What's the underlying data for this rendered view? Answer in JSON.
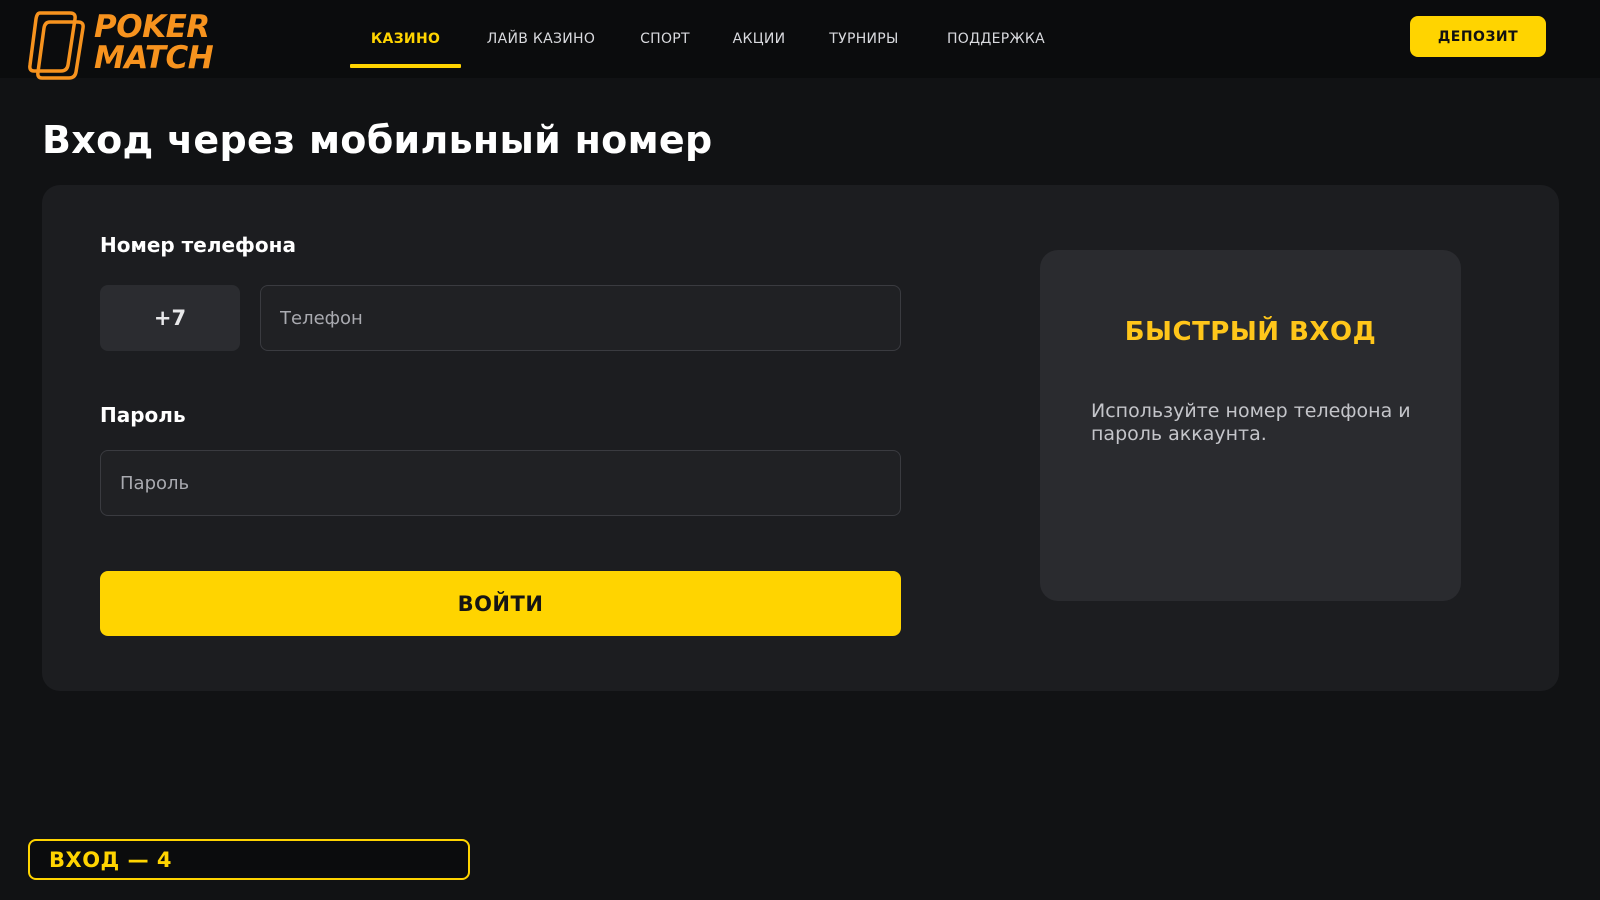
{
  "brand": {
    "line1": "POKER",
    "line2": "MATCH",
    "color": "#f7931e"
  },
  "nav": {
    "items": [
      {
        "label": "КАЗИНО",
        "active": true
      },
      {
        "label": "ЛАЙВ КАЗИНО",
        "active": false
      },
      {
        "label": "СПОРТ",
        "active": false
      },
      {
        "label": "АКЦИИ",
        "active": false
      },
      {
        "label": "ТУРНИРЫ",
        "active": false
      },
      {
        "label": "ПОДДЕРЖКА",
        "active": false
      }
    ],
    "active_color": "#ffd400"
  },
  "header": {
    "deposit_label": "ДЕПОЗИТ"
  },
  "page": {
    "title": "Вход через мобильный номер"
  },
  "form": {
    "phone_label": "Номер телефона",
    "country_code": "+7",
    "phone_value": "",
    "phone_placeholder": "Телефон",
    "password_label": "Пароль",
    "password_value": "",
    "password_placeholder": "Пароль",
    "submit_label": "ВОЙТИ"
  },
  "quick_login": {
    "title": "БЫСТРЫЙ ВХОД",
    "text": "Используйте номер телефона и пароль аккаунта."
  },
  "step_badge": {
    "label": "ВХОД — 4"
  },
  "colors": {
    "accent": "#ffd400",
    "background": "#111214",
    "card": "#1c1d20"
  },
  "icons": {
    "logo": "pokermatch-logo-icon"
  }
}
